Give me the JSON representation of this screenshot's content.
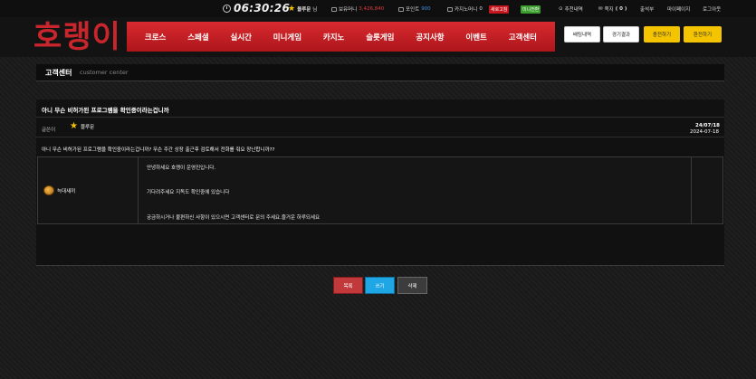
{
  "topbar": {
    "time": "06:30:26",
    "user_name": "블루문",
    "user_suffix": "님",
    "money_label": "보유머니",
    "money_value": "3,426,840",
    "point_label": "포인트",
    "point_value": "900",
    "casino_label": "카지노머니",
    "casino_value": "0",
    "refresh_label": "새로고침",
    "mini_convert_label": "미니전환",
    "recommend_label": "추천내역",
    "note_label": "쪽지",
    "note_count": "( 0 )",
    "attendance_label": "출석부",
    "mypage_label": "마이페이지",
    "logout_label": "로그아웃"
  },
  "header": {
    "logo": "호랭이",
    "nav": [
      "크로스",
      "스페셜",
      "실시간",
      "미니게임",
      "카지노",
      "슬롯게임",
      "공지사항",
      "이벤트",
      "고객센터"
    ],
    "betting_history": "배팅내역",
    "game_result": "경기결과",
    "charge": "충전하기",
    "withdraw": "환전하기"
  },
  "section": {
    "title_ko": "고객센터",
    "title_en": "customer center"
  },
  "post": {
    "title": "아니 무슨 비허가된 프로그램을 확인중이라는겁니까",
    "author_label": "글쓴이",
    "author": "블루문",
    "date": "24/07/18",
    "content": "아니 무슨 비허가된 프로그램을 확인중이라는겁니까? 무슨 주간 상장 출근후 검토해서 전화를 줘요 장난합니까??"
  },
  "reply": {
    "author": "늑대새끼",
    "line1": "안녕하세요 호랭이 운영진입니다.",
    "line2": "기다려주세요 지독도 확인중에 있습니다",
    "line3": "궁금하시거나 불편하신 사항이 있으시면 고객센터로 문의 주세요.즐거운 하루되세요",
    "date": "2024-07-18"
  },
  "buttons": {
    "list": "목록",
    "write": "쓰기",
    "delete": "삭제"
  }
}
